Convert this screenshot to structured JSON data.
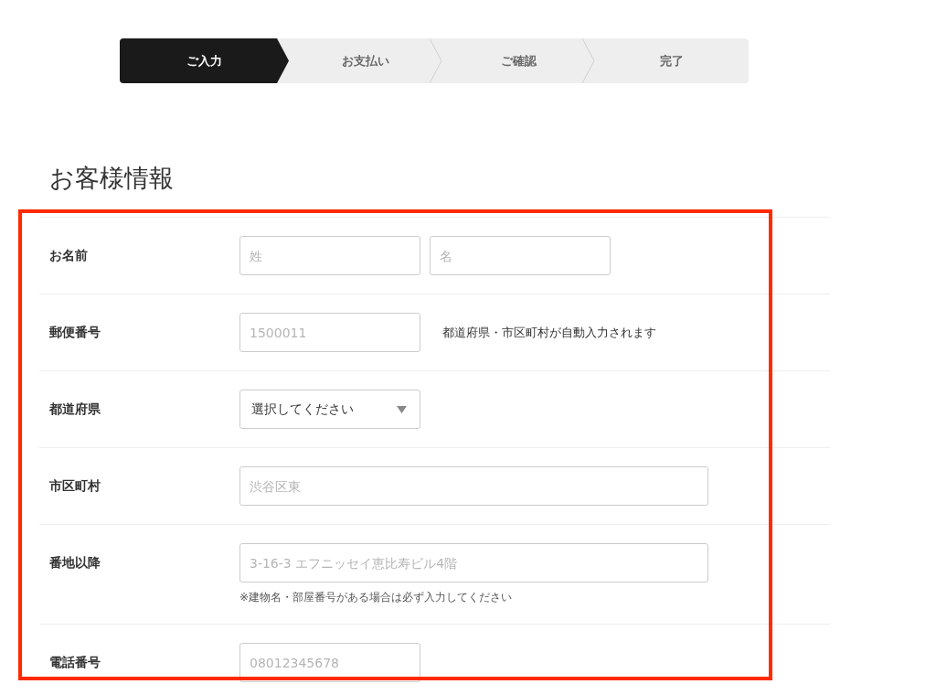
{
  "steps": [
    {
      "label": "ご入力",
      "selected": true
    },
    {
      "label": "お支払い",
      "selected": false
    },
    {
      "label": "ご確認",
      "selected": false
    },
    {
      "label": "完了",
      "selected": false
    }
  ],
  "section_title": "お客様情報",
  "form_rows": [
    {
      "label": "お名前",
      "fields": [
        {
          "kind": "short",
          "placeholder": "姓"
        },
        {
          "kind": "short",
          "placeholder": "名"
        }
      ]
    },
    {
      "label": "郵便番号",
      "fields": [
        {
          "kind": "short",
          "placeholder": "1500011"
        }
      ],
      "note": "都道府県・市区町村が自動入力されます"
    },
    {
      "label": "都道府県",
      "fields": [
        {
          "kind": "select",
          "value": "選択してください"
        }
      ]
    },
    {
      "label": "市区町村",
      "fields": [
        {
          "kind": "long",
          "placeholder": "渋谷区東"
        }
      ]
    },
    {
      "label": "番地以降",
      "fields": [
        {
          "kind": "long",
          "placeholder": "3-16-3 エフニッセイ恵比寿ビル4階"
        }
      ],
      "hint": "※建物名・部屋番号がある場合は必ず入力してください"
    },
    {
      "label": "電話番号",
      "fields": [
        {
          "kind": "short",
          "placeholder": "08012345678"
        }
      ]
    }
  ]
}
